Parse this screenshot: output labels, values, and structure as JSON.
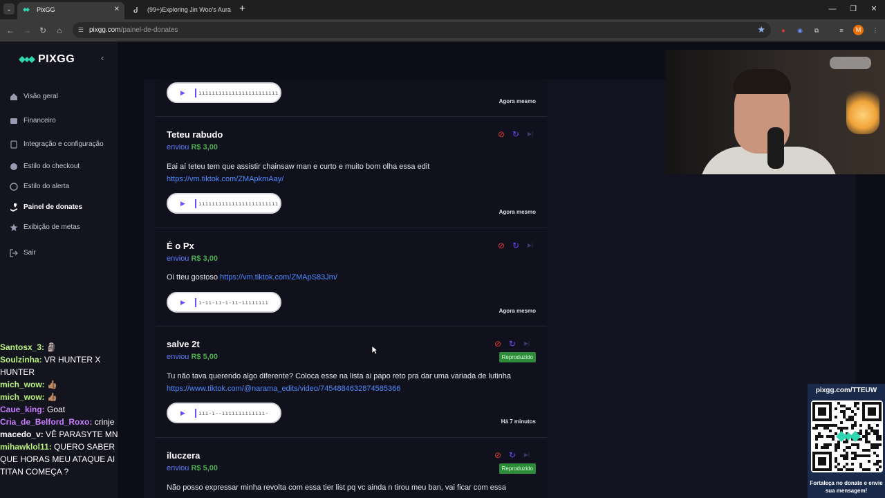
{
  "browser": {
    "tabs": [
      {
        "title": "PixGG"
      },
      {
        "title": "(99+)Exploring Jin Woo's Aura"
      }
    ],
    "url_domain": "pixgg.com",
    "url_path": "/painel-de-donates",
    "profile_initial": "M"
  },
  "sidebar": {
    "logo": "PIXGG",
    "items": [
      {
        "label": "Visão geral",
        "icon": "home-icon"
      },
      {
        "label": "Financeiro",
        "icon": "wallet-icon"
      },
      {
        "label": "Integração e configuração",
        "icon": "settings-icon"
      },
      {
        "label": "Estilo do checkout",
        "icon": "palette-icon"
      },
      {
        "label": "Estilo do alerta",
        "icon": "palette-icon"
      },
      {
        "label": "Painel de donates",
        "icon": "donate-icon"
      },
      {
        "label": "Exibição de metas",
        "icon": "star-icon"
      },
      {
        "label": "Sair",
        "icon": "logout-icon"
      }
    ],
    "active_index": 5
  },
  "chat": [
    {
      "name": "Santosx_3:",
      "msg": "🗿",
      "color": "#b9f27c"
    },
    {
      "name": "Soulzinha:",
      "msg": "VR HUNTER X HUNTER",
      "color": "#b9f27c"
    },
    {
      "name": "mich_wow:",
      "msg": "👍🏽",
      "color": "#b9f27c"
    },
    {
      "name": "mich_wow:",
      "msg": "👍🏽",
      "color": "#b9f27c"
    },
    {
      "name": "Caue_king:",
      "msg": "Goat",
      "color": "#c77dff"
    },
    {
      "name": "Cria_de_Belford_Roxo:",
      "msg": "crinje",
      "color": "#c77dff"
    },
    {
      "name": "macedo_v:",
      "msg": "VÊ PARASYTE MN",
      "color": "#ffffff"
    },
    {
      "name": "mihawklol11:",
      "msg": "QUERO SABER QUE HORAS MEU ATAQUE AI TITAN COMEÇA ?",
      "color": "#b9f27c"
    }
  ],
  "donations": [
    {
      "name": "",
      "sent": "",
      "amount": "",
      "message": "",
      "link": "",
      "time": "Agora mesmo",
      "badge": ""
    },
    {
      "name": "Teteu rabudo",
      "sent": "enviou",
      "amount": "R$ 3,00",
      "message": "Eai aí teteu tem que assistir chainsaw man e curto e muito bom olha essa edit",
      "link": "https://vm.tiktok.com/ZMApkmAay/",
      "time": "Agora mesmo",
      "badge": ""
    },
    {
      "name": "É o Px",
      "sent": "enviou",
      "amount": "R$ 3,00",
      "message": "Oi tteu gostoso",
      "link": "https://vm.tiktok.com/ZMApS83Jm/",
      "time": "Agora mesmo",
      "badge": ""
    },
    {
      "name": "salve 2t",
      "sent": "enviou",
      "amount": "R$ 5,00",
      "message": "Tu não tava querendo algo diferente? Coloca esse na lista ai papo reto pra dar uma variada de lutinha",
      "link": "https://www.tiktok.com/@narama_edits/video/7454884632874585366",
      "time": "Há 7 minutos",
      "badge": "Reproduzido"
    },
    {
      "name": "iluczera",
      "sent": "enviou",
      "amount": "R$ 5,00",
      "message": "Não posso expressar minha revolta com essa tier list pq vc ainda n tirou meu ban, vai ficar com essa",
      "link": "",
      "time": "",
      "badge": "Reproduzido"
    }
  ],
  "waveforms": [
    "ıııııııııııııııııııııııı",
    "ıııııııııııııııııııııııı",
    "ı-ıı-ıı-ı-ıı-ıııııııı",
    "ııı-ı--ııııııııııııı-"
  ],
  "qr": {
    "title": "pixgg.com/TTEUW",
    "caption": "Fortaleça no donate e envie sua mensagem!"
  },
  "colors": {
    "accent": "#6b4cff",
    "money": "#4caf50",
    "link": "#4f8bff",
    "ban": "#e53935",
    "badge": "#2e8b3a"
  }
}
